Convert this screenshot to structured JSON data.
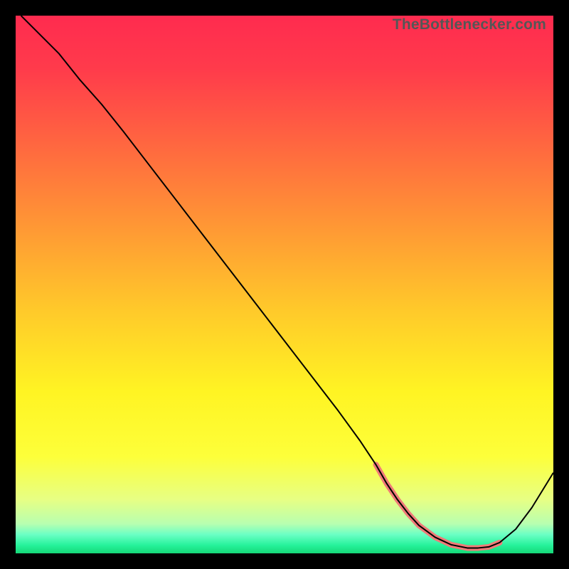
{
  "watermark": "TheBottlenecker.com",
  "chart_data": {
    "type": "line",
    "title": "",
    "xlabel": "",
    "ylabel": "",
    "xlim": [
      0,
      100
    ],
    "ylim": [
      0,
      100
    ],
    "background_gradient_stops": [
      {
        "offset": 0.0,
        "color": "#ff2b4f"
      },
      {
        "offset": 0.1,
        "color": "#ff3b4b"
      },
      {
        "offset": 0.25,
        "color": "#ff6a3f"
      },
      {
        "offset": 0.4,
        "color": "#ff9a34"
      },
      {
        "offset": 0.55,
        "color": "#ffca2a"
      },
      {
        "offset": 0.7,
        "color": "#fff423"
      },
      {
        "offset": 0.82,
        "color": "#fdff3a"
      },
      {
        "offset": 0.9,
        "color": "#e7ff84"
      },
      {
        "offset": 0.945,
        "color": "#b8ffb0"
      },
      {
        "offset": 0.965,
        "color": "#6bffc4"
      },
      {
        "offset": 0.985,
        "color": "#26f29b"
      },
      {
        "offset": 1.0,
        "color": "#15d877"
      }
    ],
    "series": [
      {
        "name": "bottleneck-curve",
        "color": "#000000",
        "stroke_width": 2,
        "x": [
          1,
          4,
          8,
          12,
          16,
          20,
          25,
          30,
          35,
          40,
          45,
          50,
          55,
          60,
          64,
          67,
          69,
          71,
          73,
          75,
          78,
          81,
          84,
          86,
          88,
          90,
          93,
          96,
          100
        ],
        "y": [
          100,
          97,
          93,
          88,
          83.5,
          78.5,
          72,
          65.5,
          59,
          52.5,
          46,
          39.5,
          33,
          26.5,
          21,
          16.5,
          13,
          10,
          7.4,
          5.2,
          3.0,
          1.6,
          1.0,
          1.0,
          1.2,
          2.0,
          4.5,
          8.5,
          15
        ]
      }
    ],
    "highlight_segment": {
      "color": "#f07a78",
      "stroke_width": 8,
      "linecap": "round",
      "x": [
        67,
        69,
        71,
        73,
        75,
        78,
        81,
        84,
        86,
        88,
        90
      ],
      "y": [
        16.5,
        13,
        10,
        7.4,
        5.2,
        3.0,
        1.6,
        1.0,
        1.0,
        1.2,
        2.0
      ]
    }
  }
}
